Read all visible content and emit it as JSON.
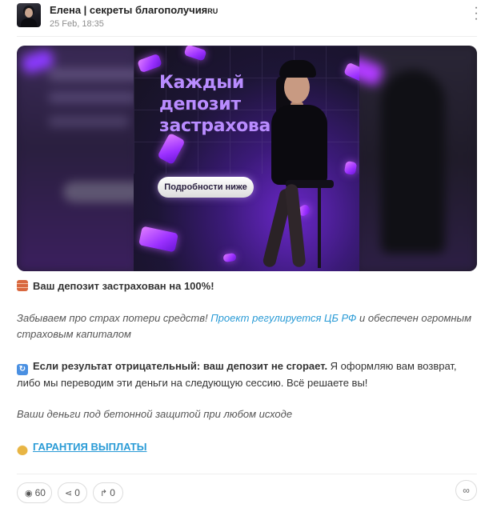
{
  "post": {
    "author": "Елена | секреты благополучия",
    "author_suffix": "RU",
    "date": "25 Feb, 18:35",
    "menu_icon": "vertical-dots-icon",
    "banner": {
      "headline": "Каждый депозит застрахован!",
      "cta": "Подробности ниже"
    },
    "lines": {
      "l1": "Ваш депозит застрахован на 100%!",
      "l2_before": "Забываем про страх потери средств! ",
      "l2_link": "Проект регулируется ЦБ РФ",
      "l2_after": " и обеспечен огромным страховым капиталом",
      "l3_bold": "Если результат отрицательный: ваш депозит не сгорает.",
      "l3_rest": " Я оформляю вам возврат, либо мы переводим эти деньги на следующую сессию. Всё решаете вы!",
      "l4": "Ваши деньги под бетонной защитой при любом исходе",
      "l5_link": "ГАРАНТИЯ ВЫПЛАТЫ"
    },
    "stats": {
      "views": "60",
      "shares": "0",
      "reposts": "0"
    },
    "icons": {
      "views": "eye-icon",
      "shares": "share-icon",
      "reposts": "repost-arrow-icon",
      "link": "link-icon"
    }
  },
  "colors": {
    "link": "#2a9bd6",
    "headline": "#b98cff"
  }
}
